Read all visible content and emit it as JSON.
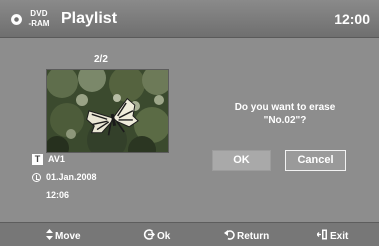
{
  "header": {
    "disc_icon": "dvd-disc-icon",
    "format_line1": "DVD",
    "format_line2": "-RAM",
    "title": "Playlist",
    "clock": "12:00"
  },
  "content": {
    "page_indicator": "2/2",
    "thumbnail_icon": "butterfly-thumbnail",
    "title_badge": "T",
    "source": "AV1",
    "date": "01.Jan.2008",
    "time": "12:06"
  },
  "dialog": {
    "line1": "Do you want to erase",
    "line2": "\"No.02\"?",
    "ok_label": "OK",
    "cancel_label": "Cancel"
  },
  "footer": {
    "move_icon": "updown-arrows-icon",
    "move_label": "Move",
    "ok_icon": "enter-icon",
    "ok_label": "Ok",
    "return_icon": "return-arrow-icon",
    "return_label": "Return",
    "exit_icon": "exit-icon",
    "exit_label": "Exit"
  }
}
